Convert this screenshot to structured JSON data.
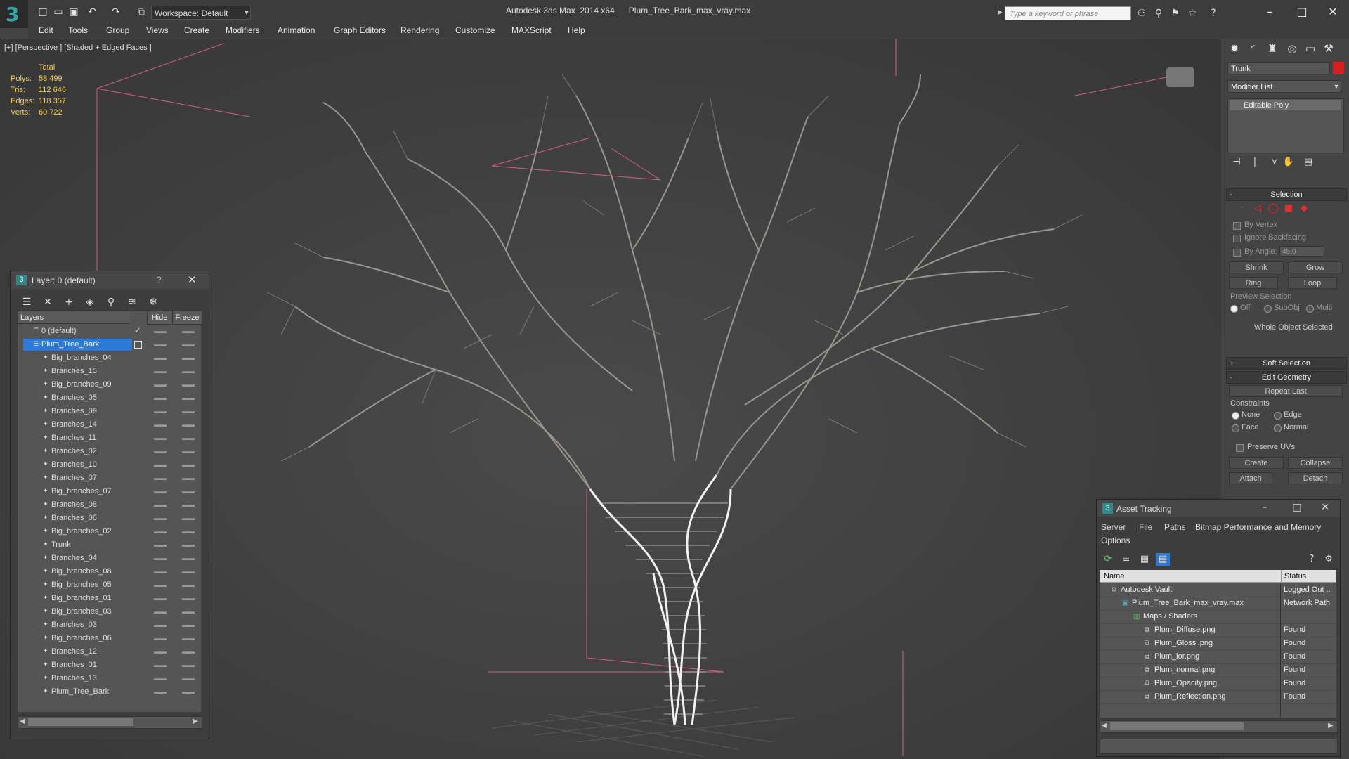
{
  "titlebar": {
    "workspace": "Workspace: Default",
    "app_title": "Autodesk 3ds Max  2014 x64      Plum_Tree_Bark_max_vray.max",
    "search_placeholder": "Type a keyword or phrase"
  },
  "menu": [
    "Edit",
    "Tools",
    "Group",
    "Views",
    "Create",
    "Modifiers",
    "Animation",
    "Graph Editors",
    "Rendering",
    "Customize",
    "MAXScript",
    "Help"
  ],
  "viewport": {
    "label": "[+] [Perspective ] [Shaded + Edged Faces ]",
    "stats": {
      "total_label": "Total",
      "rows": [
        {
          "label": "Polys:",
          "value": "58 499"
        },
        {
          "label": "Tris:",
          "value": "112 646"
        },
        {
          "label": "Edges:",
          "value": "118 357"
        },
        {
          "label": "Verts:",
          "value": "60 722"
        }
      ]
    }
  },
  "command_panel": {
    "object_name": "Trunk",
    "object_color": "#d62020",
    "modifier_list": "Modifier List",
    "stack_item": "Editable Poly",
    "selection": {
      "title": "Selection",
      "by_vertex": "By Vertex",
      "ignore_backfacing": "Ignore Backfacing",
      "by_angle": "By Angle:",
      "angle_value": "45.0",
      "shrink": "Shrink",
      "grow": "Grow",
      "ring": "Ring",
      "loop": "Loop",
      "preview_title": "Preview Selection",
      "preview_off": "Off",
      "preview_subobj": "SubObj",
      "preview_multi": "Multi",
      "status": "Whole Object Selected"
    },
    "soft_selection": "Soft Selection",
    "edit_geometry": {
      "title": "Edit Geometry",
      "repeat_last": "Repeat Last",
      "constraints": "Constraints",
      "none": "None",
      "edge": "Edge",
      "face": "Face",
      "normal": "Normal",
      "preserve_uvs": "Preserve UVs",
      "create": "Create",
      "collapse": "Collapse",
      "attach": "Attach",
      "detach": "Detach"
    }
  },
  "layer_panel": {
    "title": "Layer: 0 (default)",
    "help": "?",
    "col_layers": "Layers",
    "col_hide": "Hide",
    "col_freeze": "Freeze",
    "default_layer": "0 (default)",
    "selected_layer": "Plum_Tree_Bark",
    "objects": [
      "Big_branches_04",
      "Branches_15",
      "Big_branches_09",
      "Branches_05",
      "Branches_09",
      "Branches_14",
      "Branches_11",
      "Branches_02",
      "Branches_10",
      "Branches_07",
      "Big_branches_07",
      "Branches_08",
      "Branches_06",
      "Big_branches_02",
      "Trunk",
      "Branches_04",
      "Big_branches_08",
      "Big_branches_05",
      "Big_branches_01",
      "Big_branches_03",
      "Branches_03",
      "Big_branches_06",
      "Branches_12",
      "Branches_01",
      "Branches_13",
      "Plum_Tree_Bark"
    ]
  },
  "asset_tracking": {
    "title": "Asset Tracking",
    "menu": [
      "Server",
      "File",
      "Paths",
      "Bitmap Performance and Memory",
      "Options"
    ],
    "col_name": "Name",
    "col_status": "Status",
    "rows": [
      {
        "name": "Autodesk Vault",
        "status": "Logged Out ..",
        "level": 0
      },
      {
        "name": "Plum_Tree_Bark_max_vray.max",
        "status": "Network Path",
        "level": 1
      },
      {
        "name": "Maps / Shaders",
        "status": "",
        "level": 2
      },
      {
        "name": "Plum_Diffuse.png",
        "status": "Found",
        "level": 3
      },
      {
        "name": "Plum_Glossi.png",
        "status": "Found",
        "level": 3
      },
      {
        "name": "Plum_ior.png",
        "status": "Found",
        "level": 3
      },
      {
        "name": "Plum_normal.png",
        "status": "Found",
        "level": 3
      },
      {
        "name": "Plum_Opacity.png",
        "status": "Found",
        "level": 3
      },
      {
        "name": "Plum_Reflection.png",
        "status": "Found",
        "level": 3
      }
    ]
  }
}
